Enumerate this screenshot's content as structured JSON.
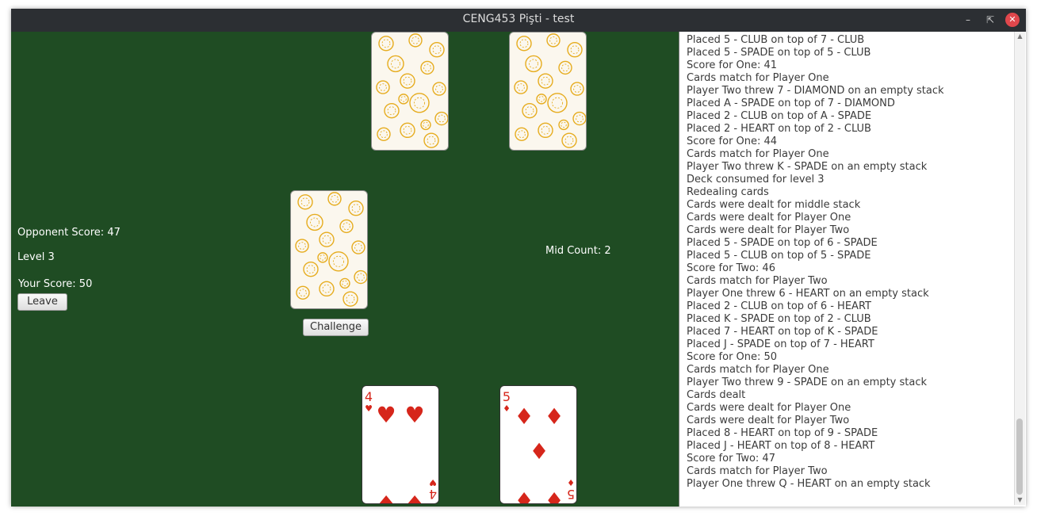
{
  "window": {
    "title": "CENG453 Pişti - test"
  },
  "colors": {
    "table": "#1f4c23",
    "card_back_pattern": "#e6ac1e",
    "suit_red": "#d6261b"
  },
  "scores": {
    "opponent_label": "Opponent Score: 47",
    "level_label": "Level 3",
    "your_label": "Your Score: 50",
    "mid_count_label": "Mid Count: 2"
  },
  "buttons": {
    "leave": "Leave",
    "challenge": "Challenge"
  },
  "opponent_cards": [
    {
      "face": "back"
    },
    {
      "face": "back"
    }
  ],
  "middle_stack": {
    "face": "back"
  },
  "player_cards": [
    {
      "rank": "4",
      "suit": "heart",
      "suit_glyph": "♥"
    },
    {
      "rank": "5",
      "suit": "diamond",
      "suit_glyph": "♦"
    }
  ],
  "log": {
    "first_partial": "Placed 5 - CLUB on top of 7 - CLUB",
    "lines": [
      "Placed 5 - CLUB on top of 7 - CLUB",
      "Placed 5 - SPADE on top of 5 - CLUB",
      "Score for One: 41",
      "Cards match for Player One",
      "Player Two threw 7 - DIAMOND on an empty stack",
      "Placed A - SPADE on top of 7 - DIAMOND",
      "Placed 2 - CLUB on top of A - SPADE",
      "Placed 2 - HEART on top of 2 - CLUB",
      "Score for One: 44",
      "Cards match for Player One",
      "Player Two threw K - SPADE on an empty stack",
      "Deck consumed for level 3",
      "Redealing cards",
      "Cards were dealt for middle stack",
      "Cards were dealt for Player One",
      "Cards were dealt for Player Two",
      "Placed 5 - SPADE on top of 6 - SPADE",
      "Placed 5 - CLUB on top of 5 - SPADE",
      "Score for Two: 46",
      "Cards match for Player Two",
      "Player One threw 6 - HEART on an empty stack",
      "Placed 2 - CLUB on top of 6 - HEART",
      "Placed K - SPADE on top of 2 - CLUB",
      "Placed 7 - HEART on top of K - SPADE",
      "Placed J - SPADE on top of 7 - HEART",
      "Score for One: 50",
      "Cards match for Player One",
      "Player Two threw 9 - SPADE on an empty stack",
      "Cards dealt",
      "Cards were dealt for Player One",
      "Cards were dealt for Player Two",
      "Placed 8 - HEART on top of 9 - SPADE",
      "Placed J - HEART on top of 8 - HEART",
      "Score for Two: 47",
      "Cards match for Player Two",
      "Player One threw Q - HEART on an empty stack"
    ]
  }
}
